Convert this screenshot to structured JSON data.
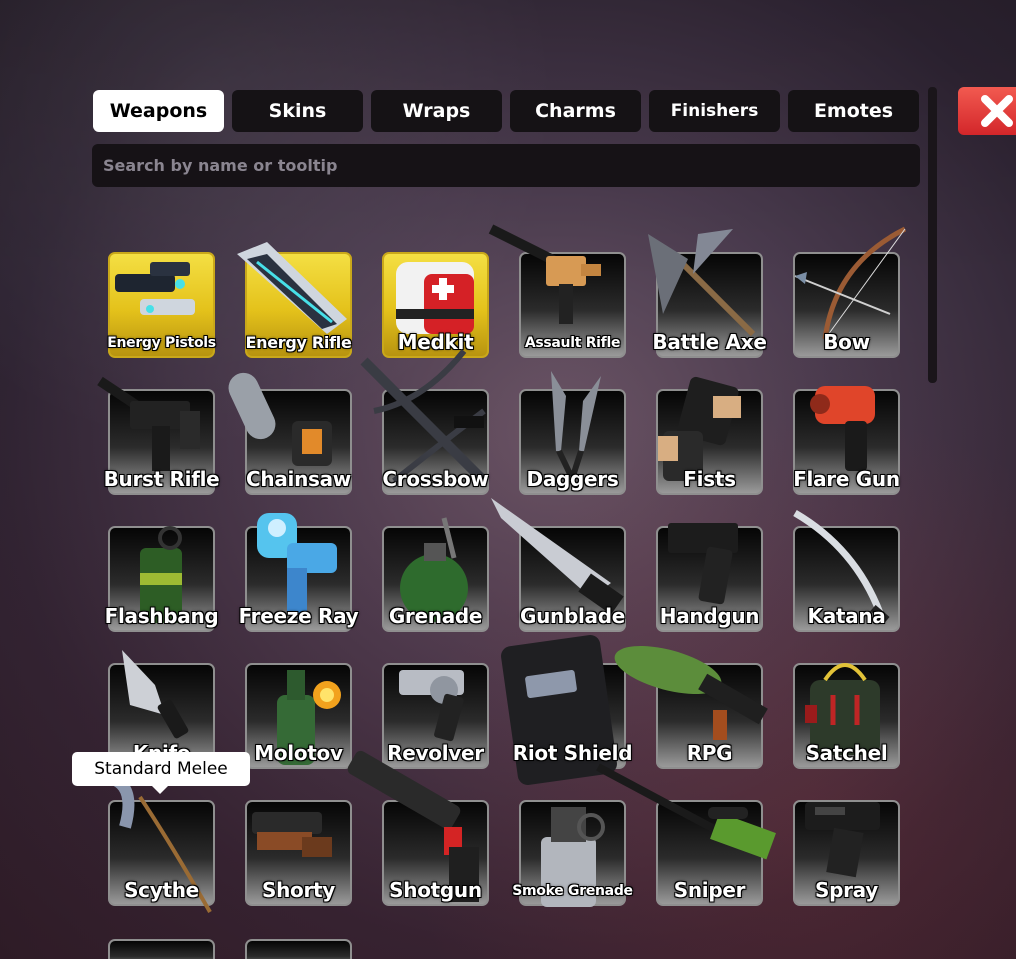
{
  "tabs": [
    {
      "label": "Weapons",
      "active": true
    },
    {
      "label": "Skins",
      "active": false
    },
    {
      "label": "Wraps",
      "active": false
    },
    {
      "label": "Charms",
      "active": false
    },
    {
      "label": "Finishers",
      "active": false
    },
    {
      "label": "Emotes",
      "active": false
    }
  ],
  "close_icon": "close-x-icon",
  "search": {
    "placeholder": "Search by name or tooltip",
    "value": ""
  },
  "tooltip": {
    "text": "Standard Melee"
  },
  "colors": {
    "gold_card": "#e9c92a",
    "close_red": "#d3262a",
    "tab_active": "#ffffff",
    "tab_inactive": "#151215"
  },
  "weapons": [
    {
      "name": "Energy Pistols",
      "icon": "energy-pistols-icon",
      "gold": true
    },
    {
      "name": "Energy Rifle",
      "icon": "energy-rifle-icon",
      "gold": true
    },
    {
      "name": "Medkit",
      "icon": "medkit-icon",
      "gold": true
    },
    {
      "name": "Assault Rifle",
      "icon": "assault-rifle-icon",
      "gold": false
    },
    {
      "name": "Battle Axe",
      "icon": "battle-axe-icon",
      "gold": false
    },
    {
      "name": "Bow",
      "icon": "bow-icon",
      "gold": false
    },
    {
      "name": "Burst Rifle",
      "icon": "burst-rifle-icon",
      "gold": false
    },
    {
      "name": "Chainsaw",
      "icon": "chainsaw-icon",
      "gold": false
    },
    {
      "name": "Crossbow",
      "icon": "crossbow-icon",
      "gold": false
    },
    {
      "name": "Daggers",
      "icon": "daggers-icon",
      "gold": false
    },
    {
      "name": "Fists",
      "icon": "fists-icon",
      "gold": false
    },
    {
      "name": "Flare Gun",
      "icon": "flare-gun-icon",
      "gold": false
    },
    {
      "name": "Flashbang",
      "icon": "flashbang-icon",
      "gold": false
    },
    {
      "name": "Freeze Ray",
      "icon": "freeze-ray-icon",
      "gold": false
    },
    {
      "name": "Grenade",
      "icon": "grenade-icon",
      "gold": false
    },
    {
      "name": "Gunblade",
      "icon": "gunblade-icon",
      "gold": false
    },
    {
      "name": "Handgun",
      "icon": "handgun-icon",
      "gold": false
    },
    {
      "name": "Katana",
      "icon": "katana-icon",
      "gold": false
    },
    {
      "name": "Knife",
      "icon": "knife-icon",
      "gold": false
    },
    {
      "name": "Molotov",
      "icon": "molotov-icon",
      "gold": false
    },
    {
      "name": "Revolver",
      "icon": "revolver-icon",
      "gold": false
    },
    {
      "name": "Riot Shield",
      "icon": "riot-shield-icon",
      "gold": false
    },
    {
      "name": "RPG",
      "icon": "rpg-icon",
      "gold": false
    },
    {
      "name": "Satchel",
      "icon": "satchel-icon",
      "gold": false
    },
    {
      "name": "Scythe",
      "icon": "scythe-icon",
      "gold": false
    },
    {
      "name": "Shorty",
      "icon": "shorty-icon",
      "gold": false
    },
    {
      "name": "Shotgun",
      "icon": "shotgun-icon",
      "gold": false
    },
    {
      "name": "Smoke Grenade",
      "icon": "smoke-grenade-icon",
      "gold": false
    },
    {
      "name": "Sniper",
      "icon": "sniper-icon",
      "gold": false
    },
    {
      "name": "Spray",
      "icon": "spray-icon",
      "gold": false
    }
  ]
}
